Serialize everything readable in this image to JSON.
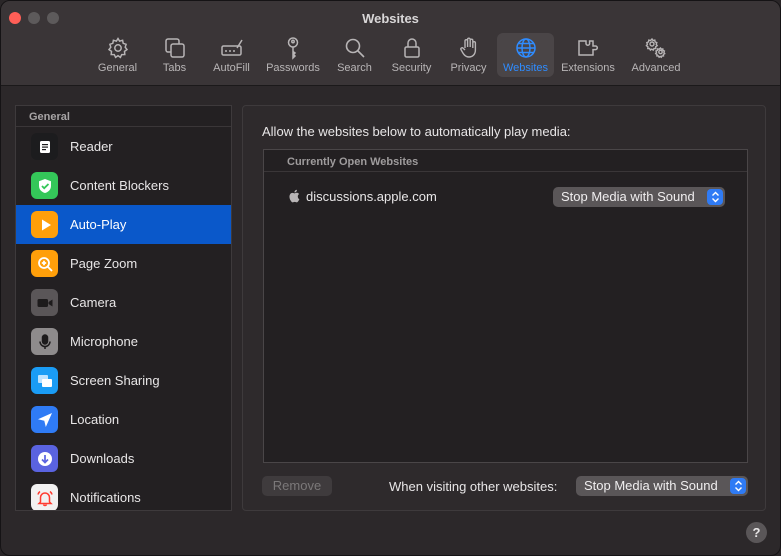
{
  "window": {
    "title": "Websites"
  },
  "toolbar": {
    "items": [
      {
        "label": "General",
        "icon": "gear-icon"
      },
      {
        "label": "Tabs",
        "icon": "tabs-icon"
      },
      {
        "label": "AutoFill",
        "icon": "autofill-pencil-icon"
      },
      {
        "label": "Passwords",
        "icon": "key-icon"
      },
      {
        "label": "Search",
        "icon": "search-icon"
      },
      {
        "label": "Security",
        "icon": "lock-icon"
      },
      {
        "label": "Privacy",
        "icon": "hand-icon"
      },
      {
        "label": "Websites",
        "icon": "globe-icon",
        "active": true
      },
      {
        "label": "Extensions",
        "icon": "puzzle-icon"
      },
      {
        "label": "Advanced",
        "icon": "gears-icon"
      }
    ]
  },
  "sidebar": {
    "header": "General",
    "items": [
      {
        "label": "Reader",
        "icon": "reader-icon",
        "color": "#1c1c1e"
      },
      {
        "label": "Content Blockers",
        "icon": "shield-check-icon",
        "color": "#34c759"
      },
      {
        "label": "Auto-Play",
        "icon": "play-icon",
        "color": "#ff9f0a",
        "selected": true
      },
      {
        "label": "Page Zoom",
        "icon": "zoom-icon",
        "color": "#ff9f0a"
      },
      {
        "label": "Camera",
        "icon": "camera-icon",
        "color": "#5a5658"
      },
      {
        "label": "Microphone",
        "icon": "microphone-icon",
        "color": "#8e8b8c"
      },
      {
        "label": "Screen Sharing",
        "icon": "screen-sharing-icon",
        "color": "#1a9cf5"
      },
      {
        "label": "Location",
        "icon": "location-icon",
        "color": "#2f7bf5"
      },
      {
        "label": "Downloads",
        "icon": "download-icon",
        "color": "#5a63e0"
      },
      {
        "label": "Notifications",
        "icon": "bell-icon",
        "color": "#f2f1f1"
      }
    ]
  },
  "main": {
    "label": "Allow the websites below to automatically play media:",
    "list_header": "Currently Open Websites",
    "sites": [
      {
        "name": "discussions.apple.com",
        "setting": "Stop Media with Sound"
      }
    ],
    "remove_label": "Remove",
    "other_label": "When visiting other websites:",
    "other_setting": "Stop Media with Sound"
  },
  "help": {
    "label": "?"
  },
  "colors": {
    "accent": "#0a58ca",
    "active_toolbar": "#2f8cff"
  }
}
